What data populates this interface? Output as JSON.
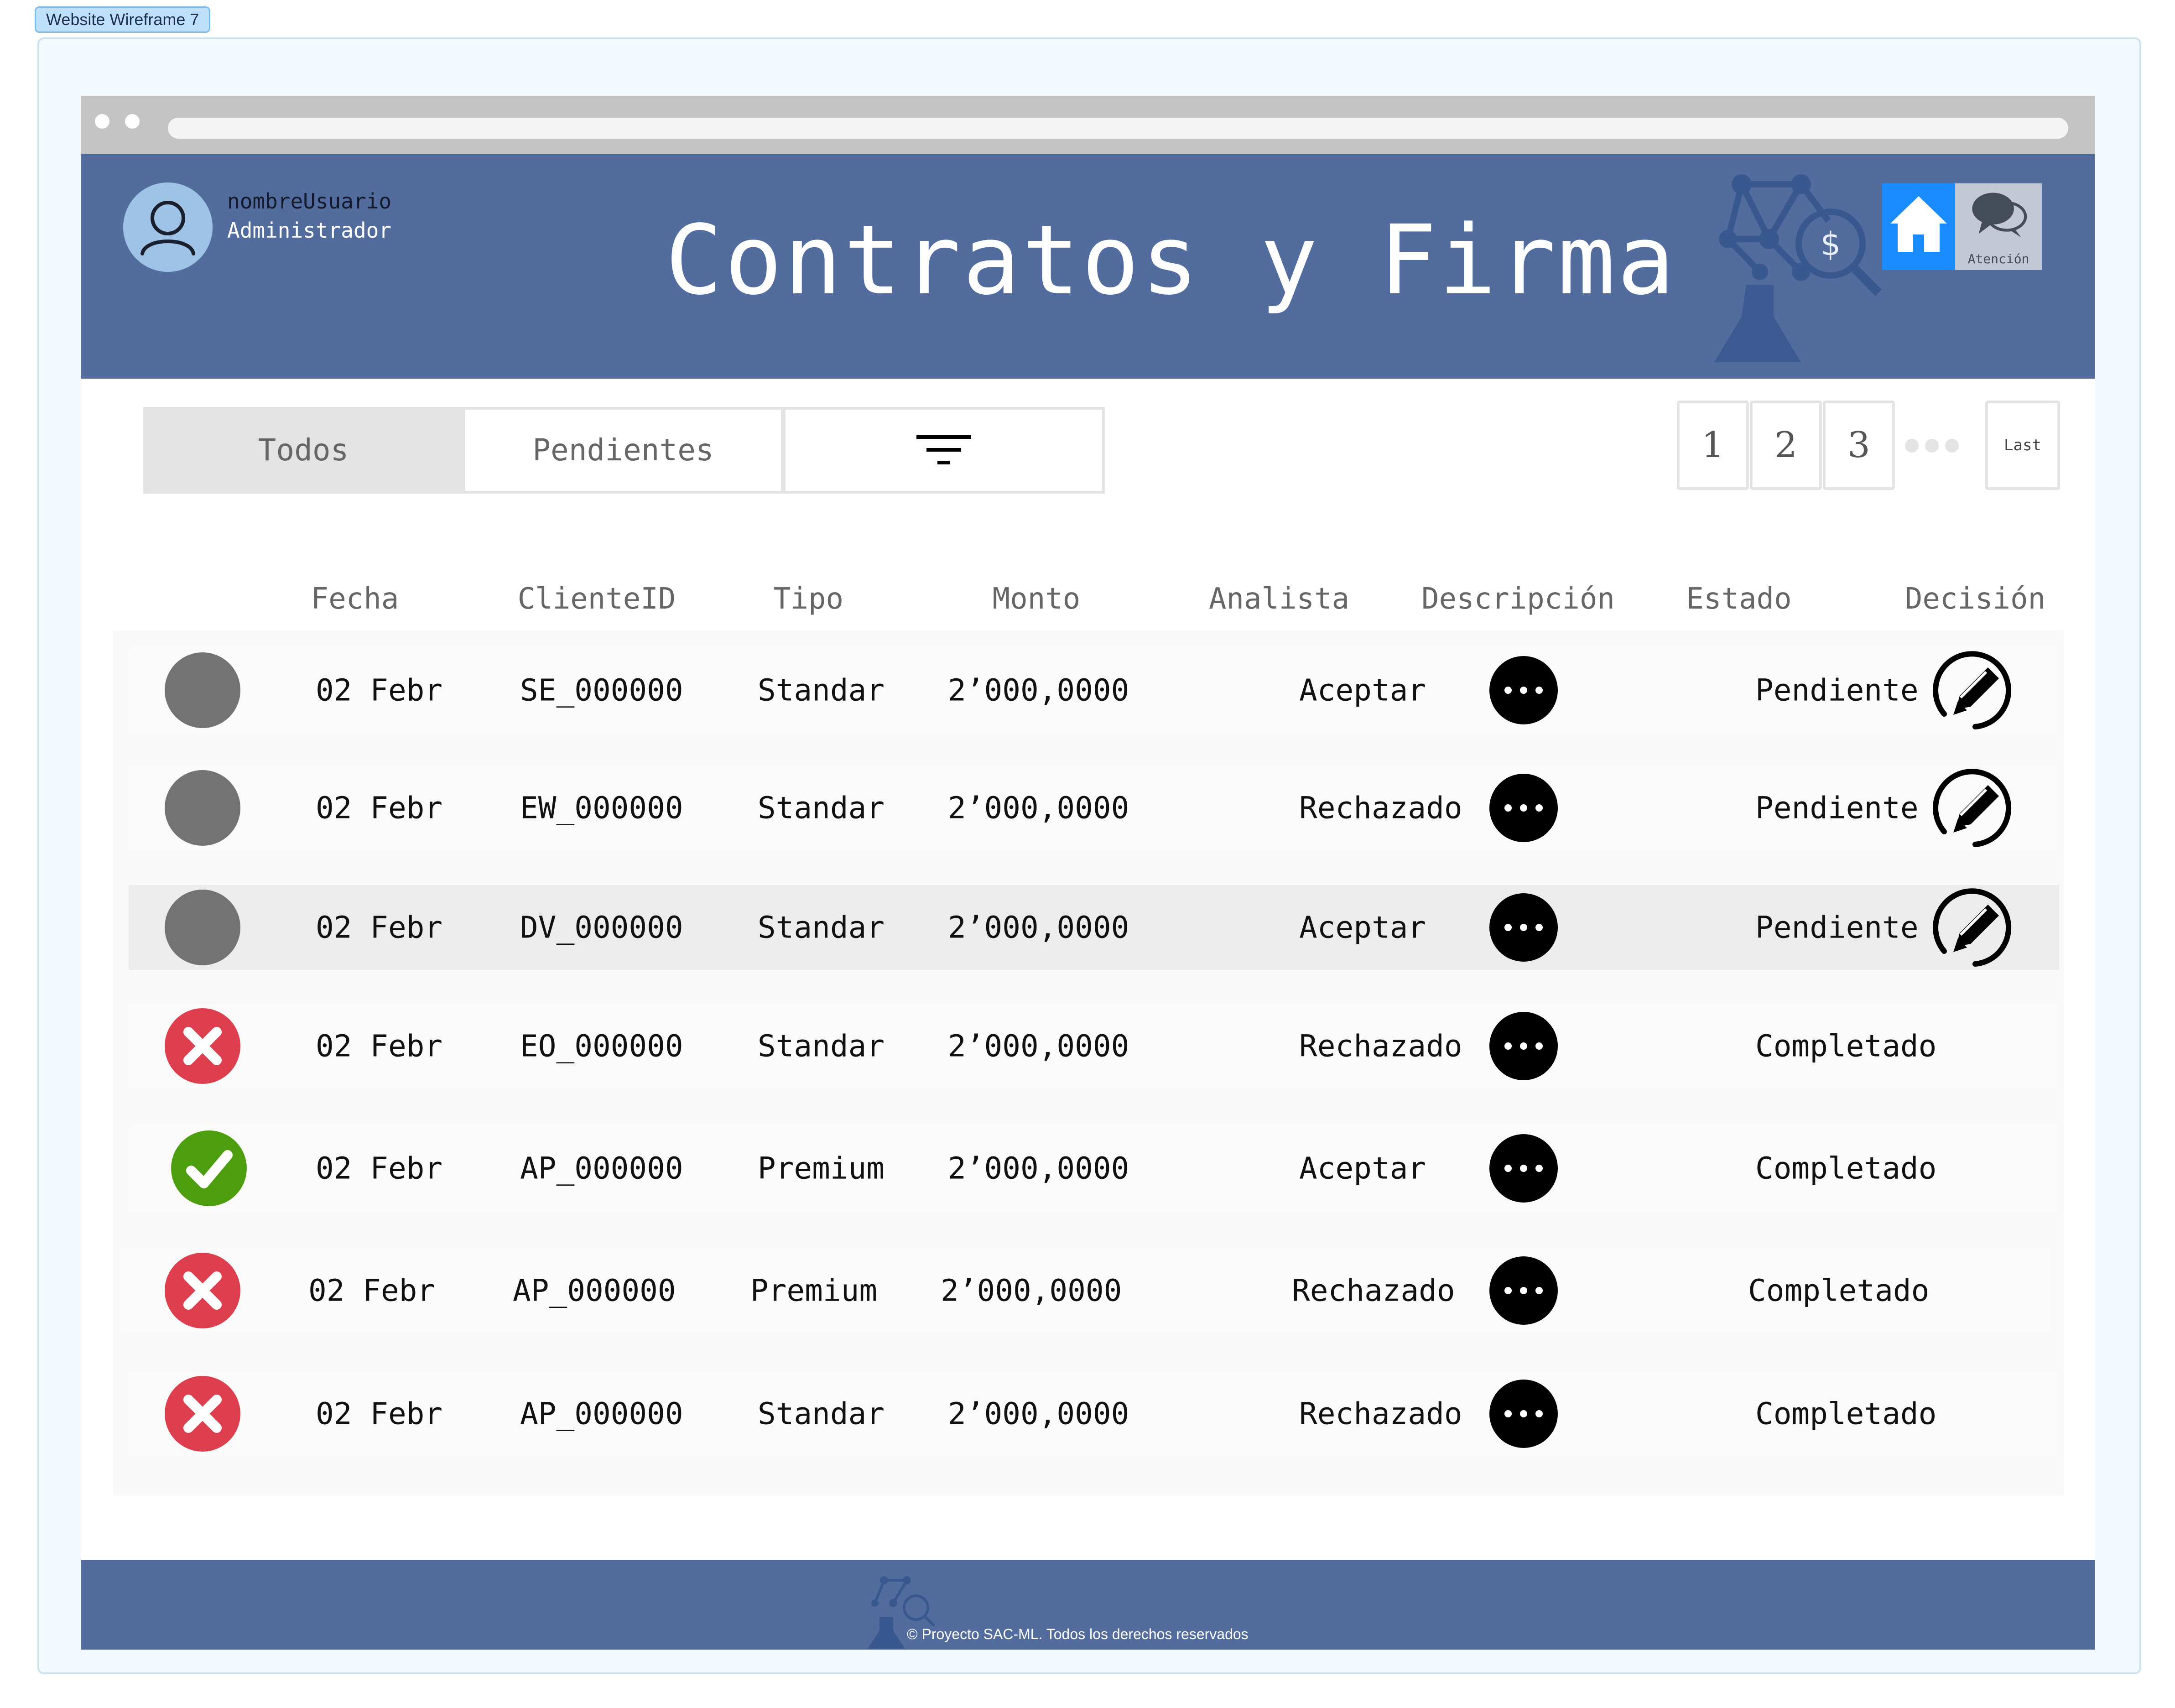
{
  "frame_label": "Website Wireframe 7",
  "user": {
    "name": "nombreUsuario",
    "role": "Administrador"
  },
  "page_title": "Contratos y Firma",
  "nav": {
    "home_icon": "home-icon",
    "attention_label": "Atención",
    "attention_icon": "chat-bubbles-icon"
  },
  "tabs": [
    {
      "label": "Todos",
      "active": true
    },
    {
      "label": "Pendientes",
      "active": false
    }
  ],
  "filter_icon": "filter-icon",
  "pagination": {
    "pages": [
      "1",
      "2",
      "3"
    ],
    "last_label": "Last"
  },
  "columns": [
    "Fecha",
    "ClienteID",
    "Tipo",
    "Monto",
    "Analista",
    "Descripción",
    "Estado",
    "Decisión"
  ],
  "rows": [
    {
      "status": "pending",
      "fecha": "02 Febr",
      "cliente": "SE_000000",
      "tipo": "Standar",
      "monto": "2’000,0000",
      "analista": "Aceptar",
      "estado": "Pendiente",
      "decision": "edit"
    },
    {
      "status": "pending",
      "fecha": "02 Febr",
      "cliente": "EW_000000",
      "tipo": "Standar",
      "monto": "2’000,0000",
      "analista": "Rechazado",
      "estado": "Pendiente",
      "decision": "edit"
    },
    {
      "status": "pending",
      "fecha": "02 Febr",
      "cliente": "DV_000000",
      "tipo": "Standar",
      "monto": "2’000,0000",
      "analista": "Aceptar",
      "estado": "Pendiente",
      "decision": "edit",
      "highlighted": true
    },
    {
      "status": "rejected",
      "fecha": "02 Febr",
      "cliente": "EO_000000",
      "tipo": "Standar",
      "monto": "2’000,0000",
      "analista": "Rechazado",
      "estado": "Completado",
      "decision": ""
    },
    {
      "status": "approved",
      "fecha": "02 Febr",
      "cliente": "AP_000000",
      "tipo": "Premium",
      "monto": "2’000,0000",
      "analista": "Aceptar",
      "estado": "Completado",
      "decision": ""
    },
    {
      "status": "rejected",
      "fecha": "02 Febr",
      "cliente": "AP_000000",
      "tipo": "Premium",
      "monto": "2’000,0000",
      "analista": "Rechazado",
      "estado": "Completado",
      "decision": ""
    },
    {
      "status": "rejected",
      "fecha": "02 Febr",
      "cliente": "AP_000000",
      "tipo": "Standar",
      "monto": "2’000,0000",
      "analista": "Rechazado",
      "estado": "Completado",
      "decision": ""
    }
  ],
  "colors": {
    "header": "#536c9e",
    "pending": "#737373",
    "rejected": "#dd3f4e",
    "approved": "#4c9e0f",
    "home": "#1a8cff"
  },
  "footer": {
    "text": "© Proyecto SAC-ML. Todos los derechos reservados"
  }
}
